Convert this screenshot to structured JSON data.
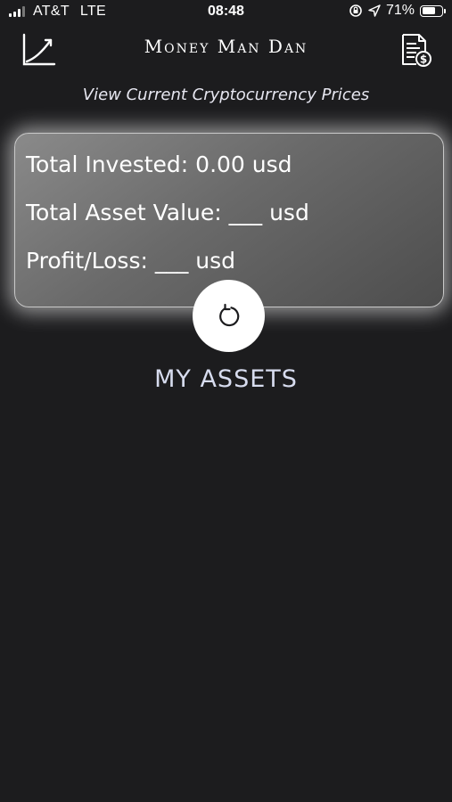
{
  "status_bar": {
    "carrier": "AT&T",
    "network": "LTE",
    "time": "08:48",
    "battery_percent": "71%",
    "battery_level": 0.71
  },
  "header": {
    "title": "Money Man Dan",
    "left_icon": "chart-trend-icon",
    "right_icon": "invoice-dollar-icon"
  },
  "prices_link": "View Current Cryptocurrency Prices",
  "summary": {
    "total_invested": "Total Invested: 0.00 usd",
    "total_asset_value": "Total Asset Value: ___ usd",
    "profit_loss": "Profit/Loss: ___ usd"
  },
  "refresh": {
    "icon": "refresh-icon"
  },
  "assets": {
    "title": "MY ASSETS"
  },
  "colors": {
    "background": "#1c1c1e",
    "card": "#6a6a6a",
    "section_title": "#d7dcef"
  }
}
